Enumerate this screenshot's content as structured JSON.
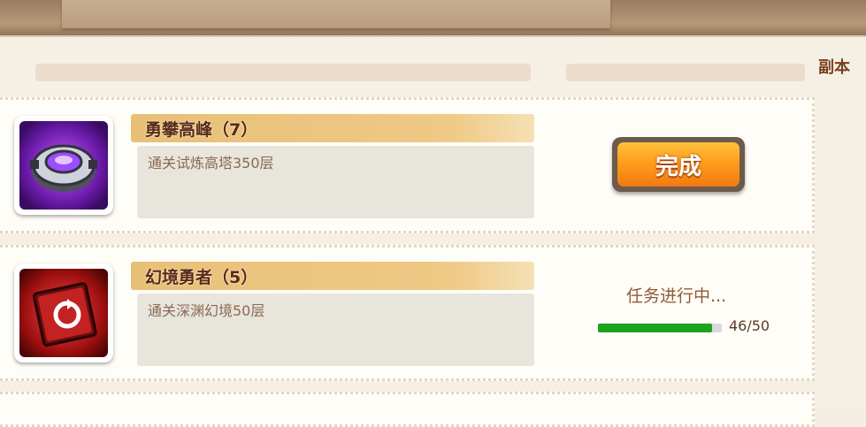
{
  "header": {
    "category_label": "副本"
  },
  "tasks": [
    {
      "title": "勇攀高峰（7）",
      "description": "通关试炼高塔350层",
      "icon": "tower-gear-icon",
      "action_label": "完成",
      "state": "complete"
    },
    {
      "title": "幻境勇者（5）",
      "description": "通关深渊幻境50层",
      "icon": "abyss-card-icon",
      "status_text": "任务进行中...",
      "progress_text": "46/50",
      "progress_fraction": 0.92,
      "state": "in-progress"
    }
  ],
  "colors": {
    "progress": "#1ba51b",
    "button": "#ff9a1b",
    "title_bar": "#e7bf77"
  }
}
